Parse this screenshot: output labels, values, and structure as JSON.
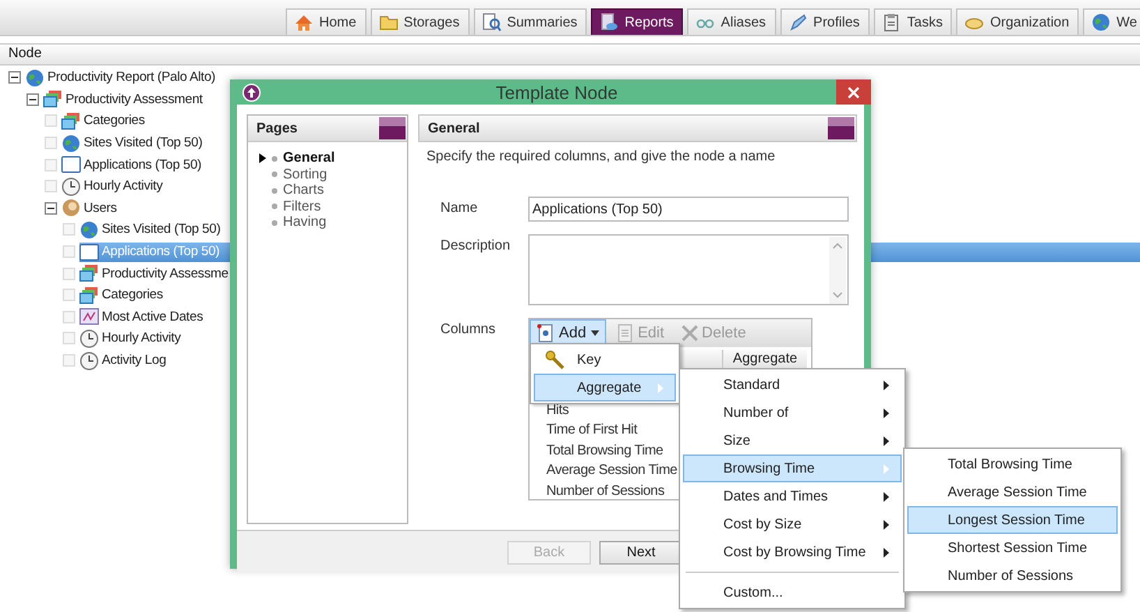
{
  "toolbar": {
    "tabs": [
      {
        "label": "Home",
        "selected": false
      },
      {
        "label": "Storages",
        "selected": false
      },
      {
        "label": "Summaries",
        "selected": false
      },
      {
        "label": "Reports",
        "selected": true
      },
      {
        "label": "Aliases",
        "selected": false
      },
      {
        "label": "Profiles",
        "selected": false
      },
      {
        "label": "Tasks",
        "selected": false
      },
      {
        "label": "Organization",
        "selected": false
      },
      {
        "label": "We",
        "selected": false
      }
    ]
  },
  "tree": {
    "header": "Node",
    "nodes": [
      {
        "label": "Productivity Report (Palo Alto)",
        "kind": "report",
        "expanded": true,
        "selected": false,
        "children": [
          {
            "label": "Productivity Assessment",
            "kind": "assessment",
            "expanded": true,
            "selected": false,
            "children": [
              {
                "label": "Categories",
                "kind": "assessment",
                "expanded": false,
                "selected": false
              },
              {
                "label": "Sites Visited (Top 50)",
                "kind": "sites",
                "expanded": false,
                "selected": false
              },
              {
                "label": "Applications (Top 50)",
                "kind": "applications",
                "expanded": false,
                "selected": false
              },
              {
                "label": "Hourly Activity",
                "kind": "timed",
                "expanded": false,
                "selected": false
              },
              {
                "label": "Users",
                "kind": "users",
                "expanded": true,
                "selected": false,
                "children": [
                  {
                    "label": "Sites Visited (Top 50)",
                    "kind": "sites",
                    "expanded": false,
                    "selected": false
                  },
                  {
                    "label": "Applications (Top 50)",
                    "kind": "applications",
                    "expanded": false,
                    "selected": true
                  },
                  {
                    "label": "Productivity Assessme",
                    "kind": "assessment",
                    "expanded": false,
                    "selected": false
                  },
                  {
                    "label": "Categories",
                    "kind": "assessment",
                    "expanded": false,
                    "selected": false
                  },
                  {
                    "label": "Most Active Dates",
                    "kind": "dates",
                    "expanded": false,
                    "selected": false
                  },
                  {
                    "label": "Hourly Activity",
                    "kind": "timed",
                    "expanded": false,
                    "selected": false
                  },
                  {
                    "label": "Activity Log",
                    "kind": "timed",
                    "expanded": false,
                    "selected": false
                  }
                ]
              }
            ]
          }
        ]
      }
    ]
  },
  "dialog": {
    "title": "Template Node",
    "pages": {
      "title": "Pages",
      "items": [
        {
          "label": "General",
          "selected": true
        },
        {
          "label": "Sorting",
          "selected": false
        },
        {
          "label": "Charts",
          "selected": false
        },
        {
          "label": "Filters",
          "selected": false
        },
        {
          "label": "Having",
          "selected": false
        }
      ]
    },
    "general": {
      "title": "General",
      "instructions": "Specify the required columns, and give the node a name",
      "name_label": "Name",
      "name_value": "Applications (Top 50)",
      "description_label": "Description",
      "columns_label": "Columns",
      "columns_toolbar": [
        {
          "label": "Add",
          "open": true,
          "disabled": false
        },
        {
          "label": "Edit",
          "open": false,
          "disabled": true
        },
        {
          "label": "Delete",
          "open": false,
          "disabled": true
        }
      ],
      "columns_list": {
        "header": "Aggregate",
        "rows": [
          "Hits",
          "Time of First Hit",
          "Total Browsing Time",
          "Average Session Time",
          "Number of Sessions"
        ]
      }
    },
    "buttons": [
      {
        "label": "Back",
        "disabled": true
      },
      {
        "label": "Next",
        "disabled": false
      }
    ]
  },
  "add_menu": {
    "items": [
      {
        "label": "Key",
        "kind": "key",
        "selected": false
      },
      {
        "label": "Aggregate",
        "kind": "submenu",
        "selected": true
      }
    ]
  },
  "aggregate_menu": {
    "items": [
      {
        "label": "Standard",
        "kind": "submenu",
        "selected": false
      },
      {
        "label": "Number of",
        "kind": "submenu",
        "selected": false
      },
      {
        "label": "Size",
        "kind": "submenu",
        "selected": false
      },
      {
        "label": "Browsing Time",
        "kind": "submenu",
        "selected": true
      },
      {
        "label": "Dates and Times",
        "kind": "submenu",
        "selected": false
      },
      {
        "label": "Cost by Size",
        "kind": "submenu",
        "selected": false
      },
      {
        "label": "Cost by Browsing Time",
        "kind": "submenu",
        "selected": false
      },
      {
        "kind": "separator"
      },
      {
        "label": "Custom...",
        "kind": "item",
        "selected": false
      }
    ]
  },
  "browsing_time_menu": {
    "items": [
      {
        "label": "Total Browsing Time",
        "kind": "item",
        "selected": false
      },
      {
        "label": "Average Session Time",
        "kind": "item",
        "selected": false
      },
      {
        "label": "Longest Session Time",
        "kind": "item",
        "selected": true
      },
      {
        "label": "Shortest Session Time",
        "kind": "item",
        "selected": false
      },
      {
        "label": "Number of Sessions",
        "kind": "item",
        "selected": false
      }
    ]
  }
}
